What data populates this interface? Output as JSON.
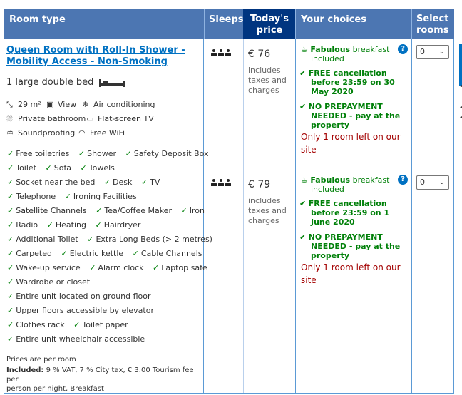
{
  "header": {
    "room_type": "Room type",
    "sleeps": "Sleeps",
    "todays_price": "Today's price",
    "your_choices": "Your choices",
    "select_rooms": "Select rooms"
  },
  "room": {
    "name_line1": "Queen Room with Roll-In Shower -",
    "name_line2": "Mobility Access - Non-Smoking",
    "bed": "1 large double bed",
    "facilities": [
      {
        "icon": "area-icon",
        "label": "29 m²"
      },
      {
        "icon": "view-icon",
        "label": "View"
      },
      {
        "icon": "air-conditioning-icon",
        "label": "Air conditioning"
      },
      {
        "icon": "bathroom-icon",
        "label": "Private bathroom"
      },
      {
        "icon": "tv-icon",
        "label": "Flat-screen TV"
      },
      {
        "icon": "soundproofing-icon",
        "label": "Soundproofing"
      },
      {
        "icon": "wifi-icon",
        "label": "Free WiFi"
      }
    ],
    "amenities": [
      [
        "Free toiletries",
        "Shower",
        "Safety Deposit Box"
      ],
      [
        "Toilet",
        "Sofa",
        "Towels"
      ],
      [
        "Socket near the bed",
        "Desk",
        "TV"
      ],
      [
        "Telephone",
        "Ironing Facilities"
      ],
      [
        "Satellite Channels",
        "Tea/Coffee Maker",
        "Iron"
      ],
      [
        "Radio",
        "Heating",
        "Hairdryer"
      ],
      [
        "Additional Toilet",
        "Extra Long Beds (> 2 metres)"
      ],
      [
        "Carpeted",
        "Electric kettle",
        "Cable Channels"
      ],
      [
        "Wake-up service",
        "Alarm clock",
        "Laptop safe"
      ],
      [
        "Wardrobe or closet"
      ],
      [
        "Entire unit located on ground floor"
      ],
      [
        "Upper floors accessible by elevator"
      ],
      [
        "Clothes rack",
        "Toilet paper"
      ],
      [
        "Entire unit wheelchair accessible"
      ]
    ],
    "prices_note": "Prices are per room",
    "included_label": "Included:",
    "included_text_1": " 9 % VAT, 7 % City tax, € 3.00 Tourism fee per",
    "included_text_2": "person per night, Breakfast"
  },
  "options": [
    {
      "price": "€ 76",
      "tax_1": "includes",
      "tax_2": "taxes and",
      "tax_3": "charges",
      "breakfast_bold": "Fabulous",
      "breakfast_rest": " breakfast",
      "breakfast_2": "included",
      "cancel_1": "FREE cancellation",
      "cancel_2": "before 23:59 on 30",
      "cancel_3": "May 2020",
      "prepay_1": "NO PREPAYMENT",
      "prepay_2": "NEEDED - pay at the",
      "prepay_3": "property",
      "left_1": "Only 1 room left on our",
      "left_2": "site",
      "select_value": "0"
    },
    {
      "price": "€ 79",
      "tax_1": "includes",
      "tax_2": "taxes and",
      "tax_3": "charges",
      "breakfast_bold": "Fabulous",
      "breakfast_rest": " breakfast",
      "breakfast_2": "included",
      "cancel_1": "FREE cancellation",
      "cancel_2": "before 23:59 on 1",
      "cancel_3": "June 2020",
      "prepay_1": "NO PREPAYMENT",
      "prepay_2": "NEEDED - pay at the",
      "prepay_3": "property",
      "left_1": "Only 1 room left on our",
      "left_2": "site",
      "select_value": "0"
    }
  ],
  "help_glyph": "?",
  "colors": {
    "header_bg": "#4c76b2",
    "header_active_bg": "#003580",
    "link": "#0071c2",
    "green": "#008009",
    "red": "#a30000",
    "border": "#5b9ad5"
  }
}
